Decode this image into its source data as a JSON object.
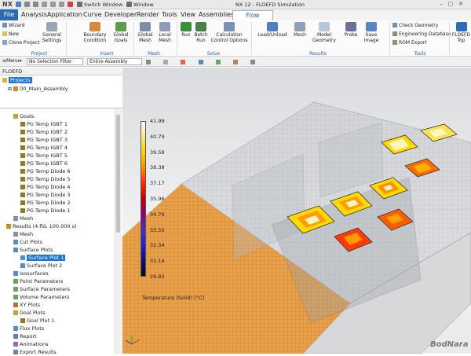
{
  "titlebar": {
    "logo": "NX",
    "switch_window": "Switch Window",
    "window_menu": "Window",
    "title": "NX 12 - FLOEFD Simulation"
  },
  "menu": {
    "file": "File",
    "tabs": [
      "Analysis",
      "Application",
      "Curve",
      "Developer",
      "Render",
      "Tools",
      "View",
      "Assemblies"
    ],
    "active_tab": "Flow Analysis"
  },
  "ribbon": {
    "project": {
      "wizard": "Wizard",
      "new": "New",
      "clone": "Clone Project",
      "general_settings": [
        "General",
        "Settings"
      ],
      "label": "Project"
    },
    "insert": {
      "boundary": [
        "Boundary",
        "Condition"
      ],
      "global_goals": [
        "Global",
        "Goals"
      ],
      "label": "Insert"
    },
    "mesh": {
      "global": [
        "Global",
        "Mesh"
      ],
      "local": [
        "Local",
        "Mesh"
      ],
      "label": "Mesh"
    },
    "solve": {
      "run": "Run",
      "batch": [
        "Batch",
        "Run"
      ],
      "calc": [
        "Calculation",
        "Control Options"
      ],
      "label": "Solve"
    },
    "results": {
      "load_unload": "Load/Unload",
      "mesh": "Mesh",
      "model_geometry": [
        "Model",
        "Geometry"
      ],
      "probe": "Probe",
      "save_image": [
        "Save",
        "Image"
      ],
      "label": "Results"
    },
    "tools": {
      "check_geometry": "Check Geometry",
      "engineering_database": "Engineering Database",
      "rom_export": "ROM Export",
      "label": "Tools"
    },
    "floefd": {
      "label": "FLOEFD",
      "sub": "Top"
    }
  },
  "filterbar": {
    "menu": "Menu",
    "selection_filter": "No Selection Filter",
    "assembly": "Entire Assembly"
  },
  "panel": {
    "header": "FLOEFD",
    "projects": "Projects",
    "assembly": "00_Main_Assembly",
    "tree": [
      {
        "label": "Goals",
        "indent": 1,
        "icon": "goals"
      },
      {
        "label": "PG Temp IGBT 1",
        "indent": 2,
        "icon": "goal"
      },
      {
        "label": "PG Temp IGBT 2",
        "indent": 2,
        "icon": "goal"
      },
      {
        "label": "PG Temp IGBT 3",
        "indent": 2,
        "icon": "goal"
      },
      {
        "label": "PG Temp IGBT 4",
        "indent": 2,
        "icon": "goal"
      },
      {
        "label": "PG Temp IGBT 5",
        "indent": 2,
        "icon": "goal"
      },
      {
        "label": "PG Temp IGBT 6",
        "indent": 2,
        "icon": "goal"
      },
      {
        "label": "PG Temp Diode 6",
        "indent": 2,
        "icon": "goal"
      },
      {
        "label": "PG Temp Diode 5",
        "indent": 2,
        "icon": "goal"
      },
      {
        "label": "PG Temp Diode 4",
        "indent": 2,
        "icon": "goal"
      },
      {
        "label": "PG Temp Diode 3",
        "indent": 2,
        "icon": "goal"
      },
      {
        "label": "PG Temp Diode 2",
        "indent": 2,
        "icon": "goal"
      },
      {
        "label": "PG Temp Diode 1",
        "indent": 2,
        "icon": "goal"
      },
      {
        "label": "Mesh",
        "indent": 1,
        "icon": "mesh"
      },
      {
        "label": "Results (4.fld, 100.000 s)",
        "indent": 0,
        "icon": "results"
      },
      {
        "label": "Mesh",
        "indent": 1,
        "icon": "mesh"
      },
      {
        "label": "Cut Plots",
        "indent": 1,
        "icon": "plot"
      },
      {
        "label": "Surface Plots",
        "indent": 1,
        "icon": "plot"
      },
      {
        "label": "Surface Plot 1",
        "indent": 2,
        "icon": "plot",
        "selected": true
      },
      {
        "label": "Surface Plot 2",
        "indent": 2,
        "icon": "plot"
      },
      {
        "label": "Isosurfaces",
        "indent": 1,
        "icon": "plot"
      },
      {
        "label": "Point Parameters",
        "indent": 1,
        "icon": "param"
      },
      {
        "label": "Surface Parameters",
        "indent": 1,
        "icon": "param"
      },
      {
        "label": "Volume Parameters",
        "indent": 1,
        "icon": "param"
      },
      {
        "label": "XY Plots",
        "indent": 1,
        "icon": "xy"
      },
      {
        "label": "Goal Plots",
        "indent": 1,
        "icon": "goals"
      },
      {
        "label": "Goal Plot 1",
        "indent": 2,
        "icon": "goal"
      },
      {
        "label": "Flux Plots",
        "indent": 1,
        "icon": "plot"
      },
      {
        "label": "Report",
        "indent": 1,
        "icon": "report"
      },
      {
        "label": "Animations",
        "indent": 1,
        "icon": "anim"
      },
      {
        "label": "Export Results",
        "indent": 1,
        "icon": "export"
      }
    ]
  },
  "legend": {
    "ticks": [
      "41.99",
      "40.79",
      "39.58",
      "38.38",
      "37.17",
      "35.96",
      "34.76",
      "33.55",
      "32.34",
      "31.14",
      "29.93"
    ],
    "colors": [
      "#ffffff",
      "#ffe680",
      "#ffd000",
      "#ff8c00",
      "#ff2a00",
      "#c20000",
      "#8a007a",
      "#4b2fb5",
      "#1f1fd6",
      "#101070",
      "#050520"
    ],
    "label": "Temperature (Solid) [°C]"
  },
  "watermark": "BodNara"
}
